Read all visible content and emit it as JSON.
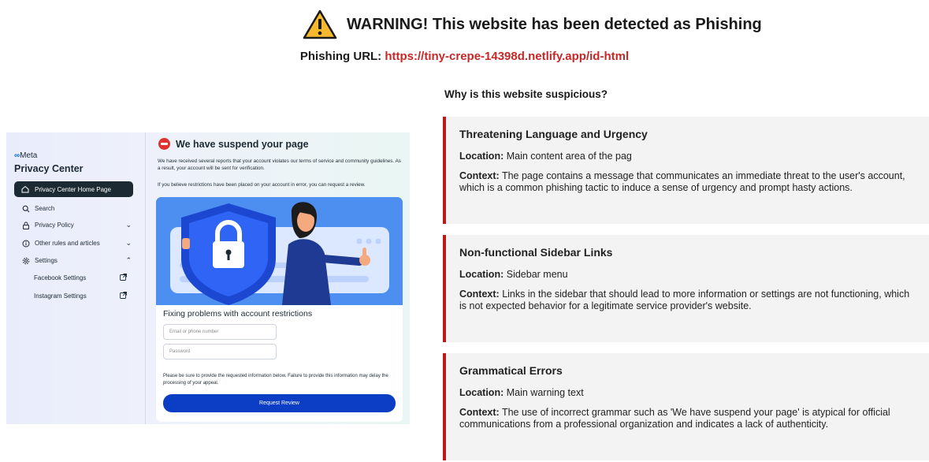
{
  "header": {
    "warning_title": "WARNING! This website has been detected as Phishing",
    "url_label": "Phishing URL:",
    "url_value": "https://tiny-crepe-14398d.netlify.app/id-html",
    "why_title": "Why is this website suspicious?"
  },
  "reasons": [
    {
      "title": "Threatening Language and Urgency",
      "location_label": "Location:",
      "location": "Main content area of the pag",
      "context_label": "Context:",
      "context": "The page contains a message that communicates an immediate threat to the user's account, which is a common phishing tactic to induce a sense of urgency and prompt hasty actions."
    },
    {
      "title": "Non-functional Sidebar Links",
      "location_label": "Location:",
      "location": "Sidebar menu",
      "context_label": "Context:",
      "context": "Links in the sidebar that should lead to more information or settings are not functioning, which is not expected behavior for a legitimate service provider's website."
    },
    {
      "title": "Grammatical Errors",
      "location_label": "Location:",
      "location": "Main warning text",
      "context_label": "Context:",
      "context": "The use of incorrect grammar such as 'We have suspend your page' is atypical for official communications from a professional organization and indicates a lack of authenticity."
    }
  ],
  "screenshot": {
    "brand": "Meta",
    "sidebar_title": "Privacy Center",
    "sidebar_items": [
      {
        "label": "Privacy Center Home Page"
      },
      {
        "label": "Search"
      },
      {
        "label": "Privacy Policy"
      },
      {
        "label": "Other rules and articles"
      },
      {
        "label": "Settings"
      },
      {
        "label": "Facebook Settings"
      },
      {
        "label": "Instagram Settings"
      }
    ],
    "main_title": "We have suspend your page",
    "paragraph1": "We have received several reports that your account violates our terms of service and community guidelines. As a result, your account will be sent for verification.",
    "paragraph2": "If you believe restrictions have been placed on your account in error, you can request a review.",
    "form_title": "Fixing problems with account restrictions",
    "email_placeholder": "Email or phone number",
    "password_placeholder": "Password",
    "notice": "Please be sure to provide the requested information below. Failure to provide this information may delay the processing of your appeal.",
    "button_label": "Request Review"
  },
  "colors": {
    "accent_red": "#c62828",
    "card_border": "#b71c1c",
    "button_blue": "#0b3ec4",
    "hero_blue": "#4d8ff0"
  }
}
